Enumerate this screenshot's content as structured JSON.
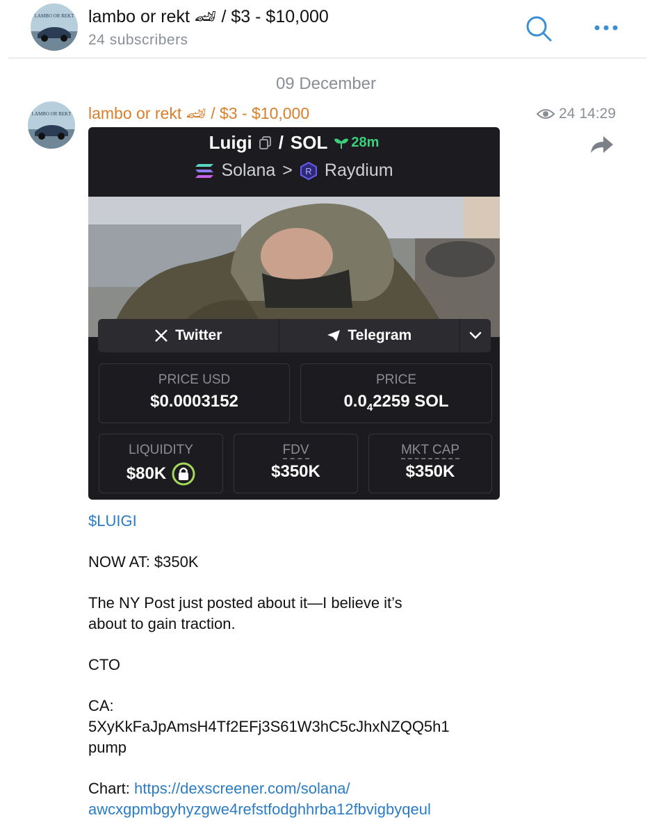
{
  "header": {
    "channel_title": "lambo or rekt 🏎 / $3 - $10,000",
    "subscribers": "24 subscribers",
    "avatar_text": "LAMBO OR REKT",
    "search_icon": "search-icon",
    "more_icon": "more-dots-icon"
  },
  "date_separator": "09 December",
  "message": {
    "sender": "lambo or rekt 🏎 / $3 - $10,000",
    "views": "24",
    "time": "14:29",
    "card": {
      "token": "Luigi",
      "pair": "SOL",
      "age": "28m",
      "chain": "Solana",
      "separator": ">",
      "dex": "Raydium",
      "links": {
        "twitter": "Twitter",
        "telegram": "Telegram"
      },
      "price_usd_label": "PRICE USD",
      "price_usd_value": "$0.0003152",
      "price_label": "PRICE",
      "price_value_prefix": "0.0",
      "price_value_sub": "4",
      "price_value_rest": "2259 SOL",
      "liquidity_label": "LIQUIDITY",
      "liquidity_value": "$80K",
      "fdv_label": "FDV",
      "fdv_value": "$350K",
      "mktcap_label": "MKT CAP",
      "mktcap_value": "$350K"
    },
    "ticker": "$LUIGI",
    "line_now": "NOW AT: $350K",
    "line_news_1": "The NY Post just posted about it—I believe it’s",
    "line_news_2": "about to gain traction.",
    "line_cto": "CTO",
    "line_ca_label": "CA:",
    "line_ca_value": "5XyKkFaJpAmsH4Tf2EFj3S61W3hC5cJhxNZQQ5h1",
    "line_ca_suffix": "pump",
    "chart_label": "Chart:",
    "chart_link_1": "https://dexscreener.com/solana/",
    "chart_link_2": "awcxgpmbgyhyzgwe4refstfodghhrba12fbvigbyqeul"
  },
  "colors": {
    "sender": "#d97e2a",
    "link": "#2a7cc6",
    "icon_blue": "#3a8fd6",
    "card_bg": "#1c1c20",
    "age_green": "#3ccf7c"
  }
}
